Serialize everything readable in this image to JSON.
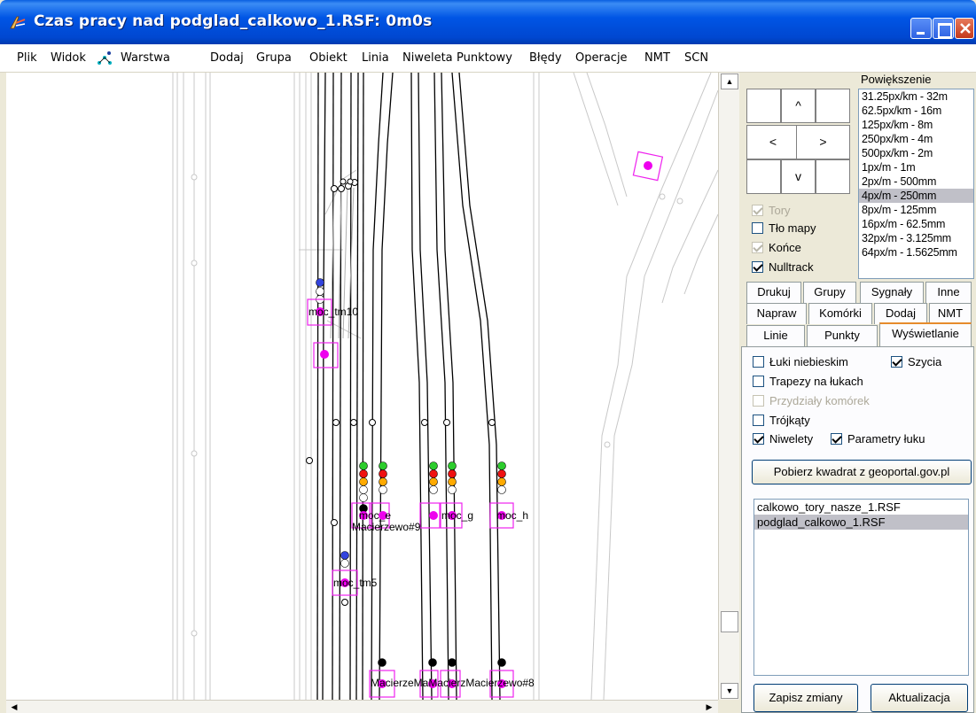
{
  "window": {
    "title": "Czas pracy nad podglad_calkowo_1.RSF: 0m0s",
    "colors": {
      "titlebar": "#0055e5",
      "selection": "#c0c0c8",
      "magenta": "#ff00ff"
    }
  },
  "menu": {
    "items": [
      "Plik",
      "Widok",
      "Warstwa",
      "Dodaj",
      "Grupa",
      "Obiekt",
      "Linia",
      "Niweleta",
      "Punktowy",
      "Błędy",
      "Operacje",
      "NMT",
      "SCN"
    ],
    "warstwa_icon": "layer-points-icon"
  },
  "canvas": {
    "labels": {
      "mc_tm10": "moc_tm10",
      "mc_e": "moc_e",
      "mc_g": "moc_g",
      "mc_h": "moc_h",
      "macierzewo9": "Macierzewo#9",
      "mc_tm5": "moc_tm5",
      "macierzewo_bottom": "MacierzeMaMacierzMacierzewo#8"
    }
  },
  "panel": {
    "nav": {
      "up": "^",
      "left": "<",
      "right": ">",
      "down": "v"
    },
    "zoom": {
      "label": "Powiększenie",
      "items": [
        "31.25px/km - 32m",
        "62.5px/km - 16m",
        "125px/km - 8m",
        "250px/km - 4m",
        "500px/km - 2m",
        "1px/m - 1m",
        "2px/m - 500mm",
        "4px/m - 250mm",
        "8px/m - 125mm",
        "16px/m - 62.5mm",
        "32px/m - 3.125mm",
        "64px/m - 1.5625mm"
      ],
      "selected": "4px/m - 250mm"
    },
    "layers": [
      {
        "label": "Tory",
        "checked": true,
        "disabled": true
      },
      {
        "label": "Tło mapy",
        "checked": false,
        "disabled": false
      },
      {
        "label": "Końce",
        "checked": true,
        "disabled": true
      },
      {
        "label": "Nulltrack",
        "checked": true,
        "disabled": false
      }
    ],
    "tabs_row1": [
      "Drukuj",
      "Grupy",
      "Sygnały",
      "Inne"
    ],
    "tabs_row2": [
      "Napraw",
      "Komórki",
      "Dodaj",
      "NMT"
    ],
    "tabs_row3": [
      "Linie",
      "Punkty",
      "Wyświetlanie"
    ],
    "active_tab": "Wyświetlanie",
    "display": {
      "luki_niebieskim": "Łuki niebieskim",
      "szycia": "Szycia",
      "trapezy": "Trapezy na łukach",
      "przydzialy": "Przydziały komórek",
      "trojkaty": "Trójkąty",
      "niwelety": "Niwelety",
      "parametry_luku": "Parametry łuku"
    },
    "geoportal_button": "Pobierz kwadrat z geoportal.gov.pl",
    "files": [
      "calkowo_tory_nasze_1.RSF",
      "podglad_calkowo_1.RSF"
    ],
    "selected_file": "podglad_calkowo_1.RSF",
    "save_button": "Zapisz zmiany",
    "update_button": "Aktualizacja"
  }
}
